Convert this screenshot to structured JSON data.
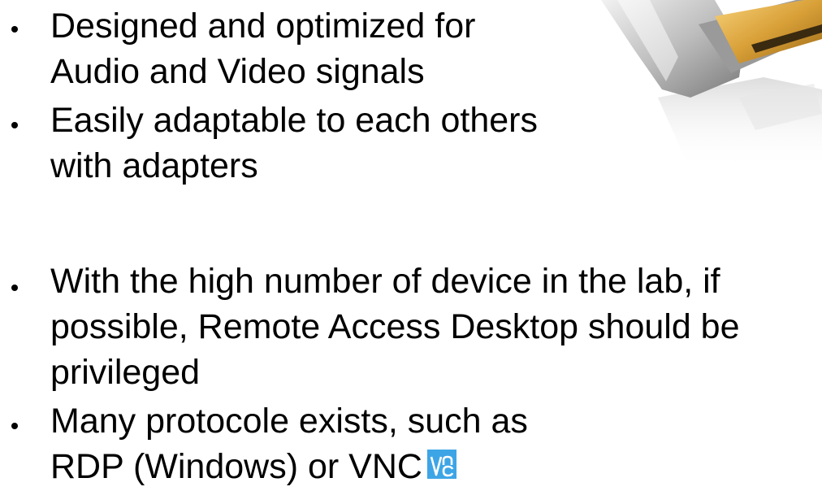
{
  "bullets_top": [
    {
      "lines": [
        "Designed and optimized for",
        "Audio and Video signals"
      ]
    },
    {
      "lines": [
        "Easily adaptable to each others",
        "with adapters"
      ]
    }
  ],
  "bullets_bottom": [
    {
      "lines": [
        "With the high number of device in the lab, if",
        "possible, Remote Access Desktop should be",
        "privileged"
      ]
    },
    {
      "lines": [
        "Many protocole exists, such as",
        "RDP (Windows) or VNC"
      ]
    }
  ],
  "logo": {
    "name": "vnc-logo",
    "color": "#3da5e6"
  },
  "image": {
    "name": "displayport-connector-image",
    "colors": {
      "gold": "#e2a93a",
      "plastic": "#c8c8c8",
      "shadow": "#8f8f8f"
    }
  }
}
